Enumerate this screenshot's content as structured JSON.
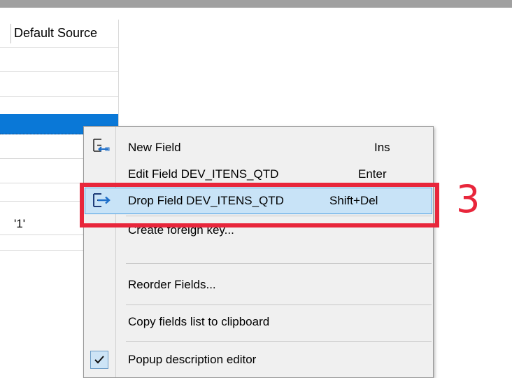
{
  "grid": {
    "column_header": "Default Source",
    "rows": [
      {
        "value": "",
        "selected": false
      },
      {
        "value": "",
        "selected": false
      },
      {
        "value": "",
        "selected": false
      },
      {
        "value": "",
        "selected": true
      },
      {
        "value": "",
        "selected": false
      },
      {
        "value": "",
        "selected": false
      },
      {
        "value": "",
        "selected": false
      },
      {
        "value": "'1'",
        "selected": false
      },
      {
        "value": "",
        "selected": false
      }
    ]
  },
  "context_menu": {
    "items": [
      {
        "label": "New Field",
        "shortcut": "Ins",
        "icon": "new-field-icon"
      },
      {
        "label": "Edit Field DEV_ITENS_QTD",
        "shortcut": "Enter",
        "icon": ""
      },
      {
        "label": "Drop Field DEV_ITENS_QTD",
        "shortcut": "Shift+Del",
        "icon": "drop-field-icon",
        "highlighted": true
      },
      {
        "label": "Create foreign key...",
        "shortcut": ""
      },
      {
        "label": "Reorder Fields...",
        "shortcut": ""
      },
      {
        "label": "Copy fields list to clipboard",
        "shortcut": ""
      },
      {
        "label": "Popup description editor",
        "shortcut": "",
        "icon": "check-icon",
        "checked": true
      }
    ]
  },
  "annotation": {
    "step_number": "3",
    "color": "#e8263b"
  },
  "colors": {
    "selection": "#0a78d7",
    "menu_highlight": "#c8e3f7",
    "menu_background": "#f0f0f0"
  }
}
